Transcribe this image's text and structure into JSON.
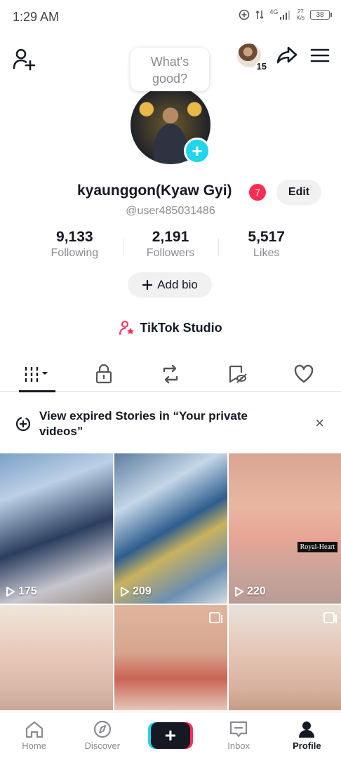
{
  "status_bar": {
    "time": "1:29 AM",
    "network": "4G",
    "speed": "27",
    "speed_unit": "K/s",
    "battery": "38"
  },
  "header": {
    "follower_count": "15"
  },
  "thought": {
    "line1": "What's",
    "line2": "good?"
  },
  "profile": {
    "name": "kyaunggon(Kyaw Gyi)",
    "notification_count": "7",
    "edit_label": "Edit",
    "handle": "@user485031486",
    "stats": [
      {
        "value": "9,133",
        "label": "Following"
      },
      {
        "value": "2,191",
        "label": "Followers"
      },
      {
        "value": "5,517",
        "label": "Likes"
      }
    ],
    "add_bio_label": "Add bio",
    "studio_label": "TikTok Studio"
  },
  "banner": {
    "text": "View expired Stories in “Your private videos”"
  },
  "videos": [
    {
      "views": "175"
    },
    {
      "views": "209"
    },
    {
      "views": "220",
      "tag": "Royal-Heart"
    },
    {
      "views": ""
    },
    {
      "views": ""
    },
    {
      "views": ""
    }
  ],
  "bottom_nav": [
    {
      "label": "Home"
    },
    {
      "label": "Discover"
    },
    {
      "label": "Inbox"
    },
    {
      "label": "Profile"
    }
  ],
  "colors": {
    "accent_red": "#fe2c55",
    "accent_cyan": "#20d5ec",
    "text": "#161823",
    "muted": "#8a8b91"
  }
}
